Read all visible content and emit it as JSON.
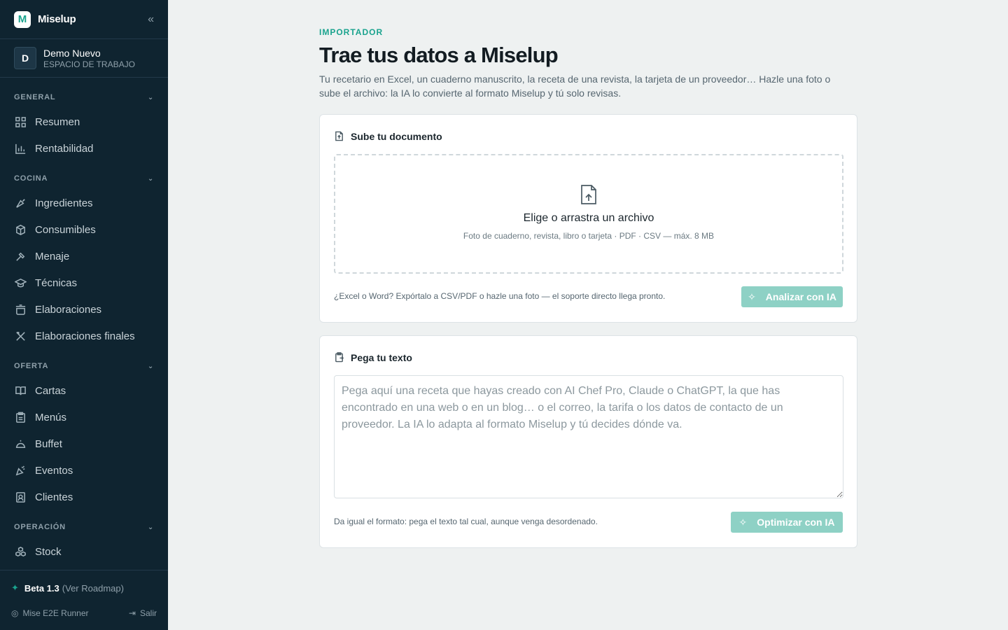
{
  "app": {
    "name": "Miselup",
    "logo_letter": "M"
  },
  "workspace": {
    "initial": "D",
    "name": "Demo Nuevo",
    "subtitle": "ESPACIO DE TRABAJO"
  },
  "sidebar": {
    "sections": [
      {
        "label": "GENERAL",
        "items": [
          {
            "label": "Resumen",
            "icon": "grid-icon"
          },
          {
            "label": "Rentabilidad",
            "icon": "bar-chart-icon"
          }
        ]
      },
      {
        "label": "COCINA",
        "items": [
          {
            "label": "Ingredientes",
            "icon": "carrot-icon"
          },
          {
            "label": "Consumibles",
            "icon": "box-icon"
          },
          {
            "label": "Menaje",
            "icon": "utensil-icon"
          },
          {
            "label": "Técnicas",
            "icon": "graduation-cap-icon"
          },
          {
            "label": "Elaboraciones",
            "icon": "pot-icon"
          },
          {
            "label": "Elaboraciones finales",
            "icon": "fork-knife-icon"
          }
        ]
      },
      {
        "label": "OFERTA",
        "items": [
          {
            "label": "Cartas",
            "icon": "book-icon"
          },
          {
            "label": "Menús",
            "icon": "clipboard-icon"
          },
          {
            "label": "Buffet",
            "icon": "cloche-icon"
          },
          {
            "label": "Eventos",
            "icon": "party-icon"
          },
          {
            "label": "Clientes",
            "icon": "contact-icon"
          }
        ]
      },
      {
        "label": "OPERACIÓN",
        "items": [
          {
            "label": "Stock",
            "icon": "boxes-icon"
          }
        ]
      }
    ],
    "footer": {
      "beta_label": "Beta 1.3",
      "roadmap_link": "(Ver Roadmap)",
      "user": "Mise E2E Runner",
      "logout": "Salir"
    }
  },
  "main": {
    "eyebrow": "IMPORTADOR",
    "title": "Trae tus datos a Miselup",
    "description": "Tu recetario en Excel, un cuaderno manuscrito, la receta de una revista, la tarjeta de un proveedor… Hazle una foto o sube el archivo: la IA lo convierte al formato Miselup y tú solo revisas.",
    "upload": {
      "heading": "Sube tu documento",
      "drop_title": "Elige o arrastra un archivo",
      "drop_subtitle": "Foto de cuaderno, revista, libro o tarjeta · PDF · CSV — máx. 8 MB",
      "hint": "¿Excel o Word? Expórtalo a CSV/PDF o hazle una foto — el soporte directo llega pronto.",
      "button": "Analizar con IA"
    },
    "paste": {
      "heading": "Pega tu texto",
      "value": "",
      "placeholder": "Pega aquí una receta que hayas creado con AI Chef Pro, Claude o ChatGPT, la que has encontrado en una web o en un blog… o el correo, la tarifa o los datos de contacto de un proveedor. La IA lo adapta al formato Miselup y tú decides dónde va.",
      "hint": "Da igual el formato: pega el texto tal cual, aunque venga desordenado.",
      "button": "Optimizar con IA"
    }
  },
  "colors": {
    "sidebar_bg": "#0f2430",
    "accent": "#1aa38e",
    "button_disabled": "#8ed1c5",
    "page_bg": "#eef1f1"
  }
}
